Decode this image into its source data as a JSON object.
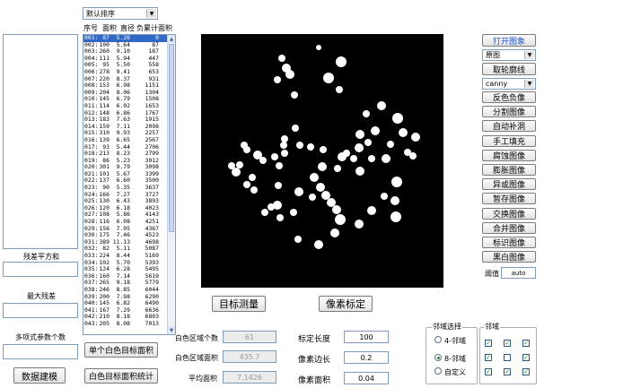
{
  "sort_combo": {
    "value": "默认排序"
  },
  "table": {
    "headers": [
      "序号",
      "面积",
      "直径",
      "负累计面积"
    ],
    "rows": [
      [
        "001:",
        "87",
        "5.26",
        "0"
      ],
      [
        "002:",
        "100",
        "5.64",
        "87"
      ],
      [
        "003:",
        "260",
        "9.10",
        "187"
      ],
      [
        "004:",
        "111",
        "5.94",
        "447"
      ],
      [
        "005:",
        "95",
        "5.50",
        "558"
      ],
      [
        "006:",
        "278",
        "9.41",
        "653"
      ],
      [
        "007:",
        "220",
        "8.37",
        "931"
      ],
      [
        "008:",
        "153",
        "6.98",
        "1151"
      ],
      [
        "009:",
        "204",
        "8.06",
        "1304"
      ],
      [
        "010:",
        "145",
        "6.79",
        "1508"
      ],
      [
        "011:",
        "114",
        "6.02",
        "1653"
      ],
      [
        "012:",
        "148",
        "6.86",
        "1767"
      ],
      [
        "013:",
        "183",
        "7.63",
        "1915"
      ],
      [
        "014:",
        "159",
        "7.11",
        "2098"
      ],
      [
        "015:",
        "310",
        "9.93",
        "2257"
      ],
      [
        "016:",
        "139",
        "6.65",
        "2567"
      ],
      [
        "017:",
        "93",
        "5.44",
        "2706"
      ],
      [
        "018:",
        "213",
        "8.23",
        "2799"
      ],
      [
        "019:",
        "86",
        "5.23",
        "3012"
      ],
      [
        "020:",
        "301",
        "9.79",
        "3098"
      ],
      [
        "021:",
        "101",
        "5.67",
        "3399"
      ],
      [
        "022:",
        "137",
        "6.60",
        "3500"
      ],
      [
        "023:",
        "90",
        "5.35",
        "3637"
      ],
      [
        "024:",
        "166",
        "7.27",
        "3727"
      ],
      [
        "025:",
        "130",
        "6.43",
        "3893"
      ],
      [
        "026:",
        "120",
        "6.18",
        "4023"
      ],
      [
        "027:",
        "108",
        "5.86",
        "4143"
      ],
      [
        "028:",
        "116",
        "6.08",
        "4251"
      ],
      [
        "029:",
        "156",
        "7.05",
        "4367"
      ],
      [
        "030:",
        "175",
        "7.46",
        "4523"
      ],
      [
        "031:",
        "389",
        "11.13",
        "4698"
      ],
      [
        "032:",
        "82",
        "5.11",
        "5087"
      ],
      [
        "033:",
        "224",
        "8.44",
        "5169"
      ],
      [
        "034:",
        "102",
        "5.70",
        "5393"
      ],
      [
        "035:",
        "124",
        "6.28",
        "5495"
      ],
      [
        "036:",
        "160",
        "7.14",
        "5619"
      ],
      [
        "037:",
        "265",
        "9.18",
        "5779"
      ],
      [
        "038:",
        "246",
        "8.85",
        "6044"
      ],
      [
        "039:",
        "200",
        "7.98",
        "6290"
      ],
      [
        "040:",
        "145",
        "6.82",
        "6490"
      ],
      [
        "041:",
        "167",
        "7.29",
        "6636"
      ],
      [
        "042:",
        "210",
        "8.18",
        "6803"
      ],
      [
        "043:",
        "205",
        "8.08",
        "7013"
      ]
    ]
  },
  "left_panel": {
    "residual_label": "残差平方和",
    "max_residual_label": "最大残差",
    "poly_label": "多项式参数个数",
    "build_model_button": "数据建模"
  },
  "single_white_button": "单个白色目标面积",
  "white_stats_button": "白色目标面积统计",
  "measure_button": "目标测量",
  "calibrate_button": "像素标定",
  "region_stats": {
    "count_label": "白色区域个数",
    "count_value": "61",
    "area_label": "白色区域面积",
    "area_value": "435.7",
    "avg_label": "平均面积",
    "avg_value": "7.1426"
  },
  "calibration": {
    "length_label": "标定长度",
    "length_value": "100",
    "pixel_edge_label": "像素边长",
    "pixel_edge_value": "0.2",
    "pixel_area_label": "像素面积",
    "pixel_area_value": "0.04"
  },
  "neighborhood": {
    "group_label": "邻域选择",
    "options": [
      "4-邻域",
      "8-邻域",
      "自定义"
    ],
    "selected": "8-邻域",
    "grid_label": "邻域",
    "grid": [
      [
        true,
        true,
        true
      ],
      [
        true,
        false,
        true
      ],
      [
        true,
        true,
        true
      ]
    ]
  },
  "right_panel": {
    "open_image_button": "打开图象",
    "image_combo": "原图",
    "contour_button": "取轮廓线",
    "edge_combo": "canny",
    "buttons": [
      "反色负像",
      "分割图像",
      "自动补洞",
      "手工填充",
      "腐蚀图像",
      "膨胀图像",
      "异或图像",
      "暂存图像",
      "交换图像",
      "合并图像",
      "标识图像",
      "黑白图像"
    ],
    "threshold_label": "阈值",
    "threshold_value": "auto"
  },
  "colors": {
    "accent_blue": "#2255cc",
    "selection": "#3169c6"
  }
}
